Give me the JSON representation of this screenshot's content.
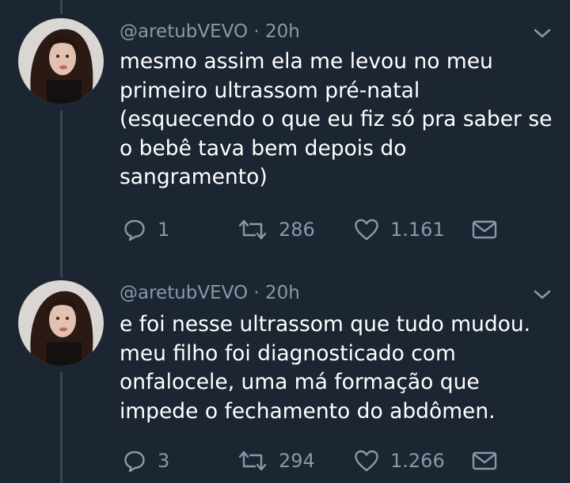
{
  "tweets": [
    {
      "handle": "@aretubVEVO",
      "separator": "·",
      "time": "20h",
      "lines": [
        "mesmo assim ela me levou no meu",
        "primeiro ultrassom pré-natal",
        "(esquecendo o que eu fiz só pra saber se",
        "o bebê tava bem depois do",
        "sangramento)"
      ],
      "replies": "1",
      "retweets": "286",
      "likes": "1.161"
    },
    {
      "handle": "@aretubVEVO",
      "separator": "·",
      "time": "20h",
      "lines": [
        "e foi nesse ultrassom que tudo mudou.",
        "meu filho foi diagnosticado com",
        "onfalocele, uma má formação que",
        "impede o fechamento do abdômen."
      ],
      "replies": "3",
      "retweets": "294",
      "likes": "1.266"
    }
  ],
  "icons": {
    "reply": "reply-icon",
    "retweet": "retweet-icon",
    "like": "heart-icon",
    "dm": "mail-icon",
    "menu": "chevron-down-icon"
  },
  "colors": {
    "background": "#1c2532",
    "text": "#ffffff",
    "muted": "#8899a6",
    "thread_line": "#38444d"
  }
}
